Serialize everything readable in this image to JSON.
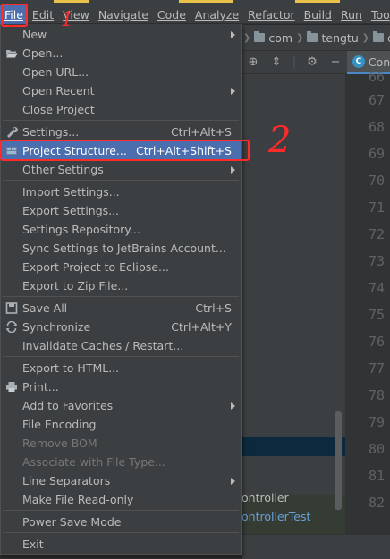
{
  "menubar": {
    "items": [
      {
        "label": "File",
        "active": true
      },
      {
        "label": "Edit",
        "active": false
      },
      {
        "label": "View",
        "active": false
      },
      {
        "label": "Navigate",
        "active": false
      },
      {
        "label": "Code",
        "active": false
      },
      {
        "label": "Analyze",
        "active": false
      },
      {
        "label": "Refactor",
        "active": false
      },
      {
        "label": "Build",
        "active": false
      },
      {
        "label": "Run",
        "active": false
      },
      {
        "label": "Too",
        "active": false
      }
    ]
  },
  "breadcrumb": {
    "items": [
      "com",
      "tengtu",
      "den"
    ]
  },
  "editor_tab": {
    "label": "Con"
  },
  "line_numbers": [
    "66",
    "67",
    "68",
    "69",
    "70",
    "71",
    "72",
    "73",
    "74",
    "75",
    "76",
    "77",
    "78",
    "79",
    "80",
    "81",
    "82"
  ],
  "project_files": [
    "ontroller",
    "ontrollerTest"
  ],
  "file_menu": {
    "items": [
      {
        "label": "New",
        "submenu": true
      },
      {
        "label": "Open...",
        "icon": "folder-open-icon"
      },
      {
        "label": "Open URL..."
      },
      {
        "label": "Open Recent",
        "submenu": true
      },
      {
        "label": "Close Project"
      },
      {
        "label": "Settings...",
        "shortcut": "Ctrl+Alt+S",
        "icon": "wrench-icon"
      },
      {
        "label": "Project Structure...",
        "shortcut": "Ctrl+Alt+Shift+S",
        "icon": "project-structure-icon",
        "selected": true
      },
      {
        "label": "Other Settings",
        "submenu": true
      },
      {
        "label": "Import Settings..."
      },
      {
        "label": "Export Settings..."
      },
      {
        "label": "Settings Repository..."
      },
      {
        "label": "Sync Settings to JetBrains Account..."
      },
      {
        "label": "Export Project to Eclipse..."
      },
      {
        "label": "Export to Zip File..."
      },
      {
        "label": "Save All",
        "shortcut": "Ctrl+S",
        "icon": "save-icon"
      },
      {
        "label": "Synchronize",
        "shortcut": "Ctrl+Alt+Y",
        "icon": "sync-icon"
      },
      {
        "label": "Invalidate Caches / Restart..."
      },
      {
        "label": "Export to HTML..."
      },
      {
        "label": "Print...",
        "icon": "print-icon"
      },
      {
        "label": "Add to Favorites",
        "submenu": true
      },
      {
        "label": "File Encoding"
      },
      {
        "label": "Remove BOM",
        "disabled": true
      },
      {
        "label": "Associate with File Type...",
        "disabled": true
      },
      {
        "label": "Line Separators",
        "submenu": true
      },
      {
        "label": "Make File Read-only"
      },
      {
        "label": "Power Save Mode"
      },
      {
        "label": "Exit"
      }
    ]
  },
  "annotations": {
    "mark_1": "1",
    "mark_2": "2",
    "color": "#ff2a2a"
  },
  "colors": {
    "menu_bg": "#3c3f41",
    "selected_bg": "#4b6eaf",
    "editor_bg": "#2b2b2b"
  }
}
